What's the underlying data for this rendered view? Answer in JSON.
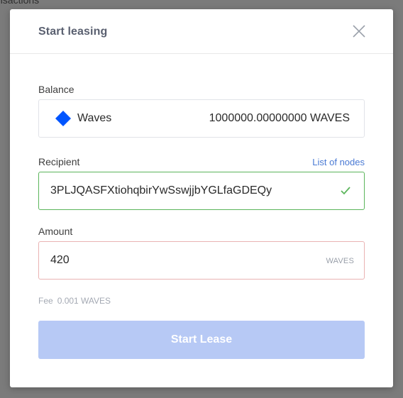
{
  "background": {
    "partial_text": "nsactions"
  },
  "modal": {
    "title": "Start leasing",
    "balance": {
      "label": "Balance",
      "asset_name": "Waves",
      "amount": "1000000.00000000 WAVES",
      "asset_icon": "waves-diamond-icon",
      "asset_color": "#0055ff"
    },
    "recipient": {
      "label": "Recipient",
      "nodes_link": "List of nodes",
      "value": "3PLJQASFXtiohqbirYwSswjjbYGLfaGDEQy",
      "status_icon": "check-icon",
      "valid_color": "#5bb55b"
    },
    "amount": {
      "label": "Amount",
      "value": "420",
      "unit": "WAVES",
      "error_border_color": "#eab3b3"
    },
    "fee": {
      "label": "Fee",
      "value": "0.001 WAVES"
    },
    "submit": {
      "label": "Start Lease",
      "disabled_color": "#b7c9f5"
    }
  }
}
